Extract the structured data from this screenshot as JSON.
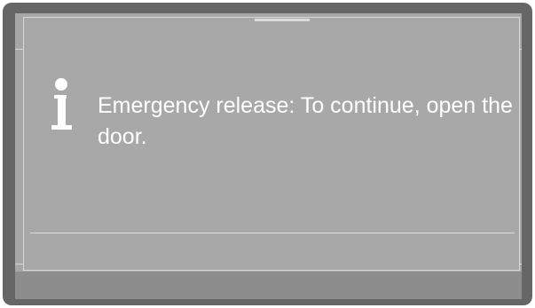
{
  "dialog": {
    "message": "Emergency release: To continue, open the door.",
    "icon": "info-icon"
  },
  "colors": {
    "bezel": "#666667",
    "screen": "#a7a7a8",
    "bottom_strip": "#8d8d8e",
    "text": "#ffffff",
    "lines": "#dcdcdc"
  }
}
